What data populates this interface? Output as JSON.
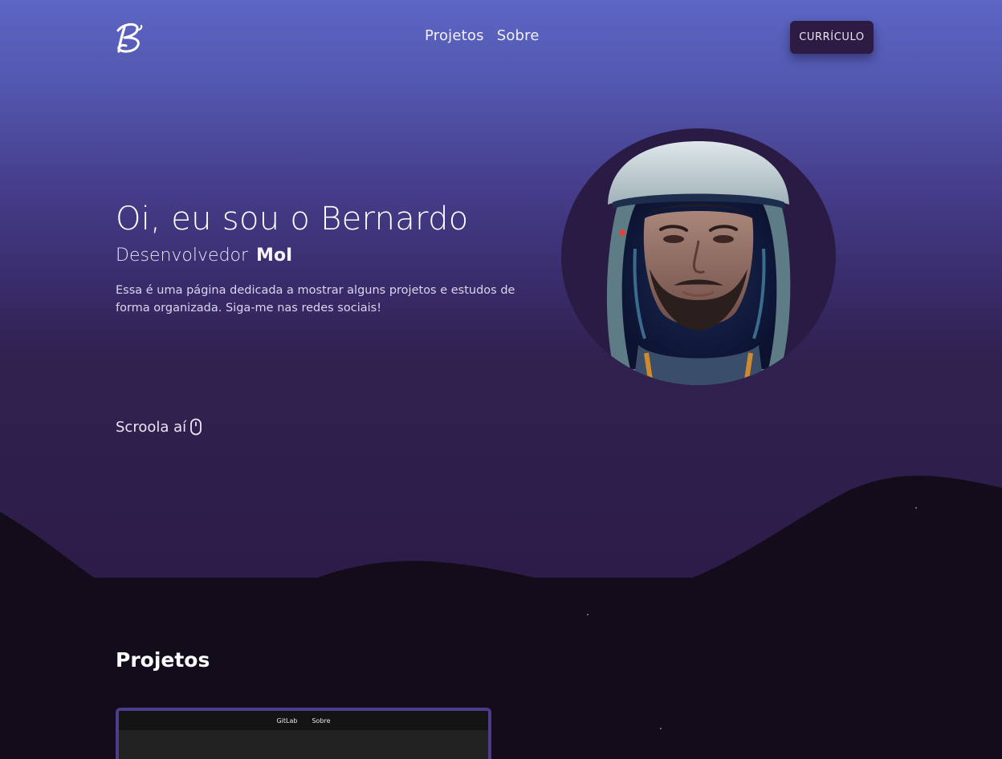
{
  "header": {
    "logo_icon": "signature-b-logo",
    "nav_items": [
      "Projetos",
      "Sobre"
    ],
    "cv_button_label": "CURRÍCULO"
  },
  "hero": {
    "title": "Oi, eu sou o Bernardo",
    "subtitle_prefix": "Desenvolvedor",
    "subtitle_typed": "MoI",
    "description": "Essa é uma página dedicada a mostrar alguns projetos e estudos de forma organizada. Siga-me nas redes sociais!",
    "scroll_hint": "Scroola aí",
    "scroll_icon": "mouse-icon",
    "avatar_icon": "astronaut-portrait"
  },
  "projects": {
    "title": "Projetos",
    "preview_nav": [
      "GitLab",
      "Sobre"
    ]
  },
  "colors": {
    "hero_top": "#5c66c4",
    "hero_bottom": "#2d1c49",
    "page_dark": "#130c1b",
    "button_bg": "#2e1b43",
    "card_border": "#4d3b8c"
  }
}
